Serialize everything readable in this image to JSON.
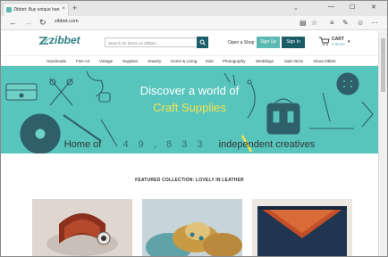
{
  "browser": {
    "tab_title": "Zibbet: Buy unique han",
    "tab_close": "×",
    "new_tab": "+",
    "url": "zibbet.com",
    "window_controls": [
      "—",
      "☐",
      "✕"
    ]
  },
  "header": {
    "logo_text": "zibbet",
    "search_placeholder": "Search for items on Zibbet...",
    "open_shop": "Open a Shop",
    "sign_up": "Sign Up",
    "sign_in": "Sign In",
    "cart_label": "CART",
    "cart_items": "0 Items"
  },
  "categories": [
    "Handmade",
    "Fine Art",
    "Vintage",
    "Supplies",
    "Jewelry",
    "Home & Living",
    "Kids",
    "Photography",
    "Weddings",
    "Sale Items",
    "About Zibbet"
  ],
  "hero": {
    "title": "Discover a world of",
    "subtitle": "Craft Supplies"
  },
  "stats": {
    "prefix": "Home of",
    "digits": [
      "4",
      "9",
      ",",
      "8",
      "3",
      "3"
    ],
    "suffix": "independent creatives"
  },
  "featured_label": "FEATURED COLLECTION: LOVELY IN LEATHER",
  "colors": {
    "teal": "#58c5bd",
    "dark_teal": "#1b5d66",
    "yellow": "#f4e24c"
  }
}
